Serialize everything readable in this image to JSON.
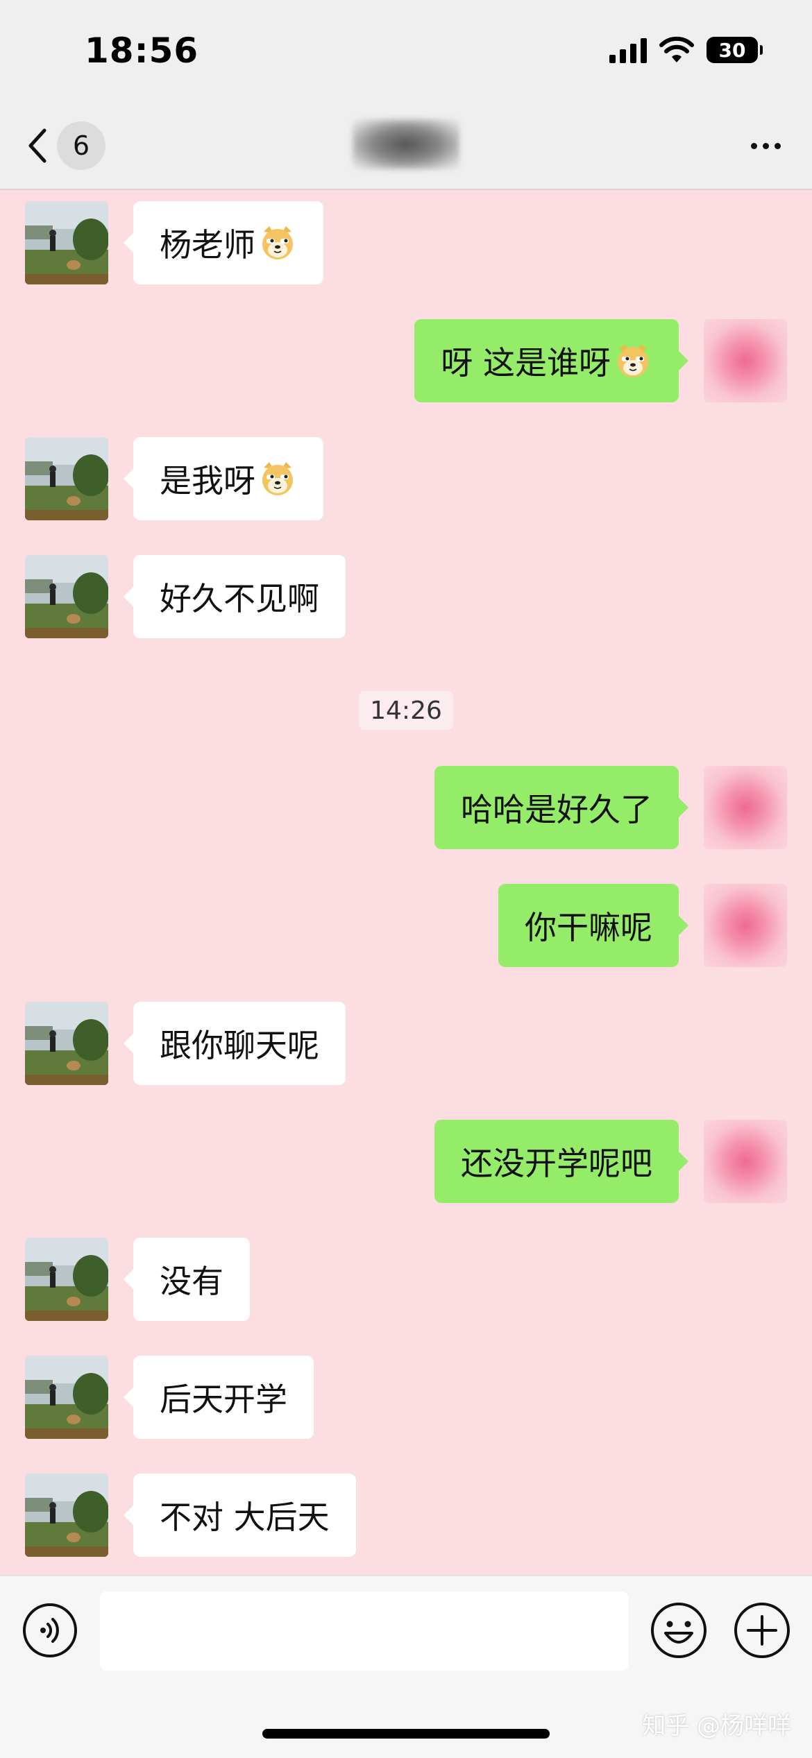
{
  "status_bar": {
    "time": "18:56",
    "battery": "30"
  },
  "nav": {
    "unread_count": "6"
  },
  "messages": [
    {
      "side": "left",
      "text": "杨老师",
      "emoji": "doge-face"
    },
    {
      "side": "right",
      "text": "呀 这是谁呀",
      "emoji": "doge-face"
    },
    {
      "side": "left",
      "text": "是我呀",
      "emoji": "doge-face"
    },
    {
      "side": "left",
      "text": "好久不见啊"
    },
    {
      "side": "right",
      "text": "哈哈是好久了"
    },
    {
      "side": "right",
      "text": "你干嘛呢"
    },
    {
      "side": "left",
      "text": "跟你聊天呢"
    },
    {
      "side": "right",
      "text": "还没开学呢吧"
    },
    {
      "side": "left",
      "text": "没有"
    },
    {
      "side": "left",
      "text": "后天开学"
    },
    {
      "side": "left",
      "text": "不对 大后天"
    }
  ],
  "timestamp": "14:26",
  "input": {
    "placeholder": ""
  },
  "watermark": "知乎 @杨咩咩",
  "colors": {
    "chat_bg": "#fbdde2",
    "sent_bubble": "#95ec69",
    "received_bubble": "#ffffff"
  }
}
